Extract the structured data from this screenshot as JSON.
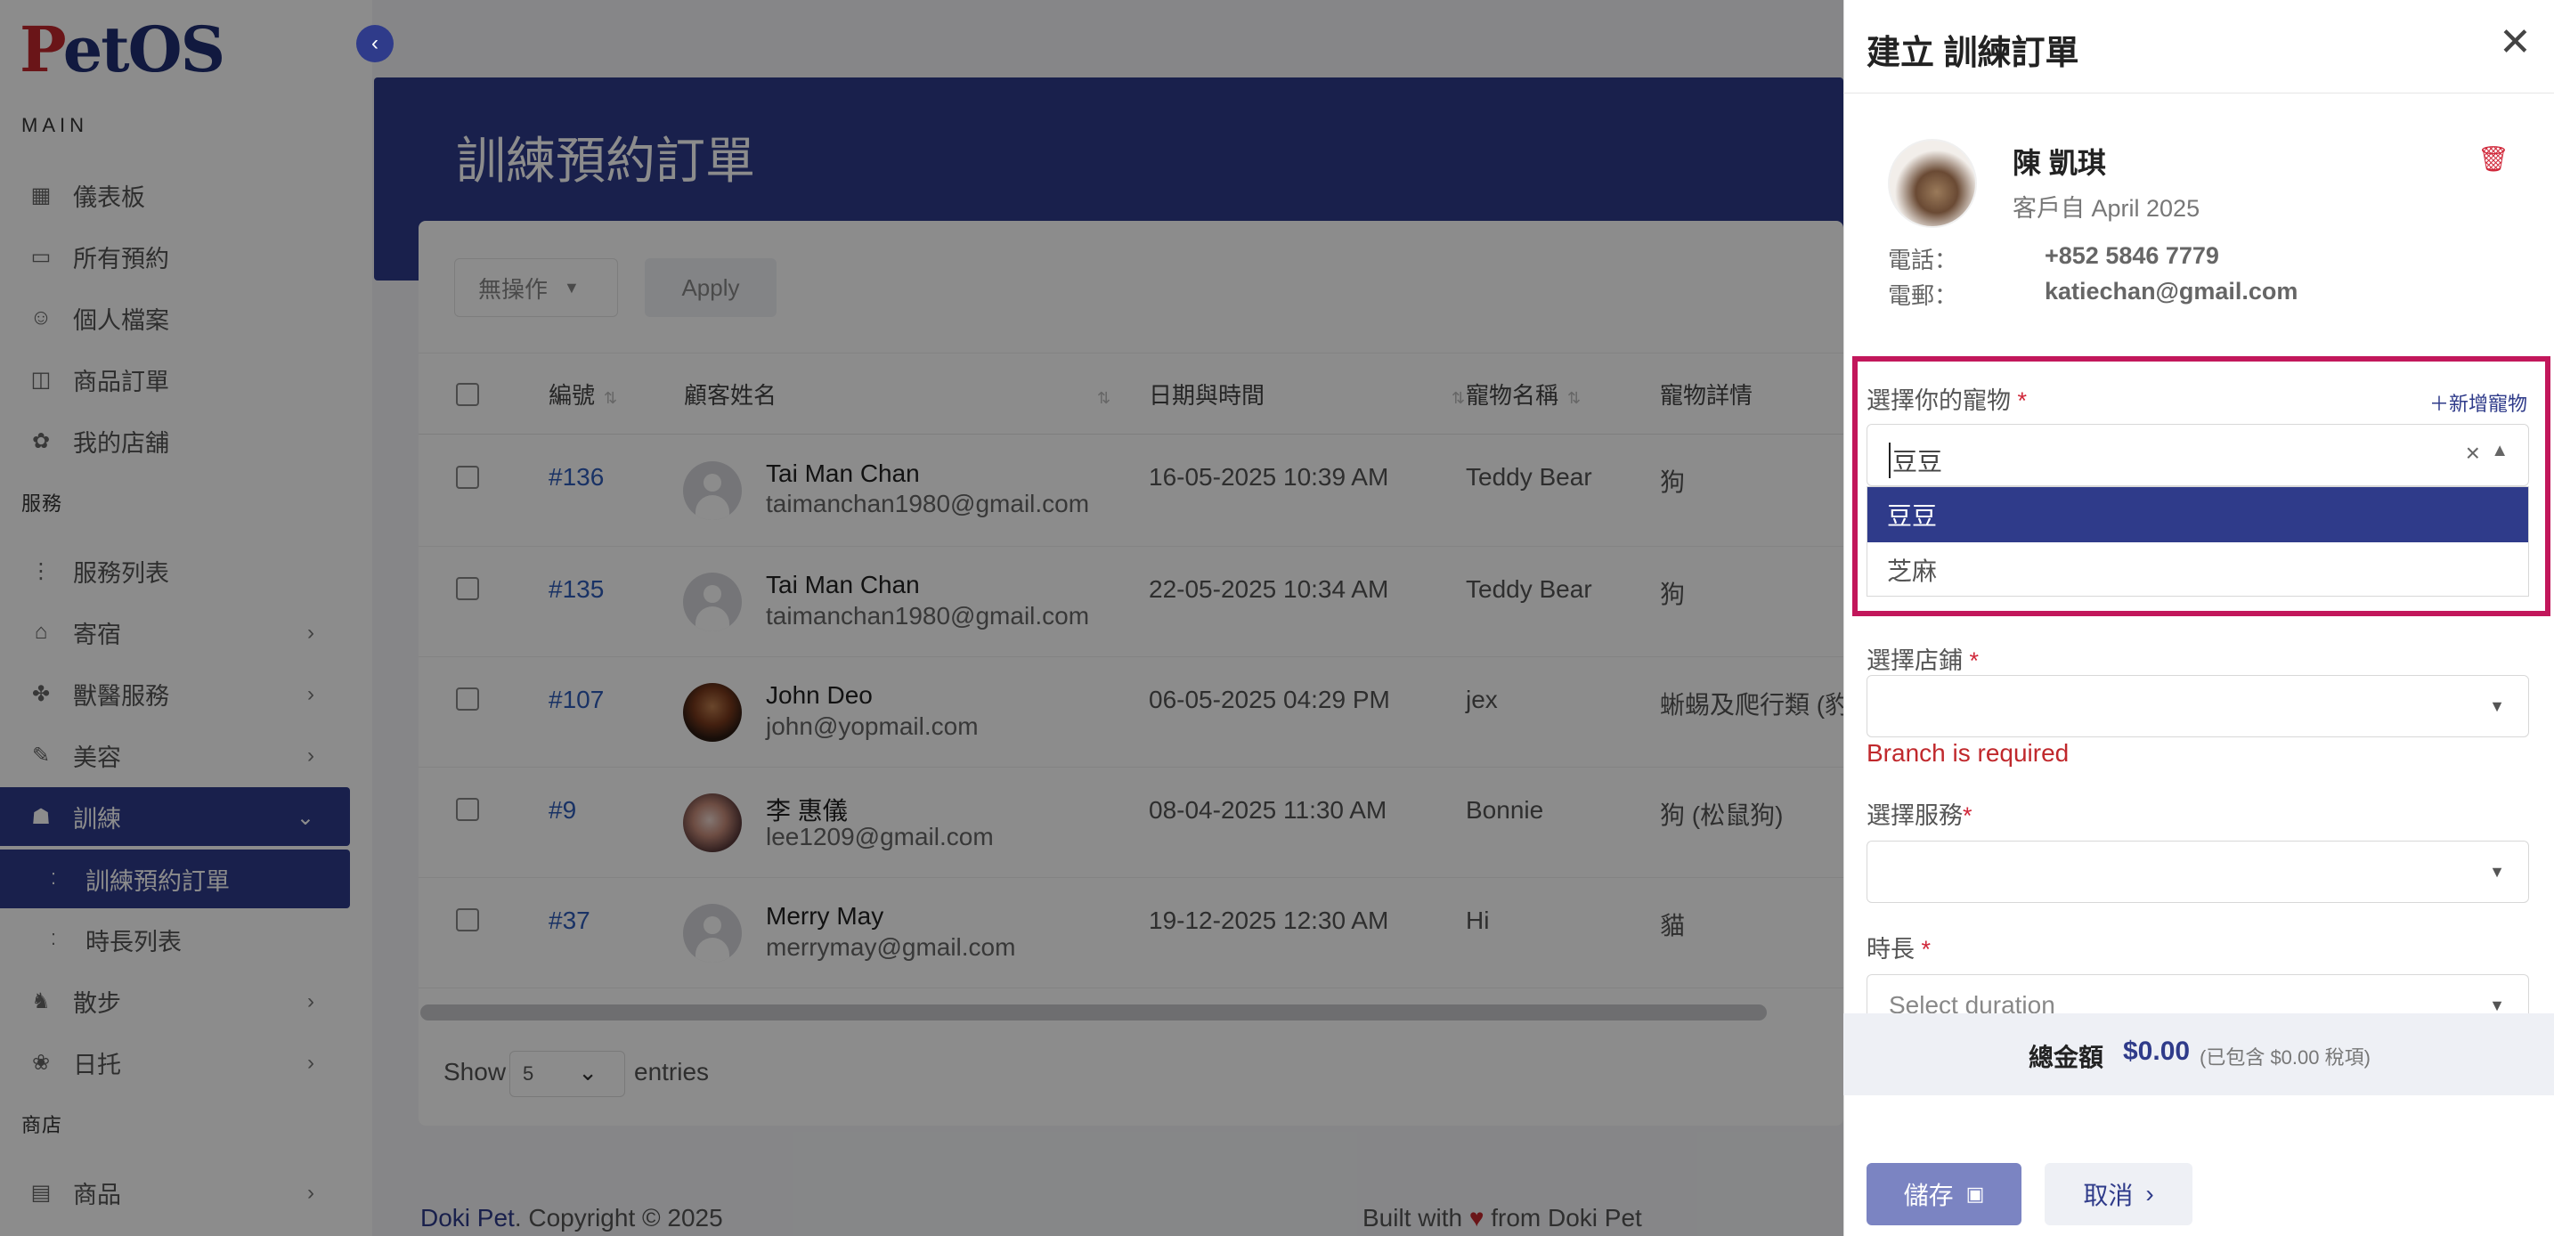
{
  "app": {
    "logo_p": "P",
    "logo_rest": "etOS"
  },
  "sidebar": {
    "section_main": "MAIN",
    "section_services": "服務",
    "section_shop": "商店",
    "items": [
      {
        "label": "儀表板",
        "icon": "dashboard-icon"
      },
      {
        "label": "所有預約",
        "icon": "calendar-icon"
      },
      {
        "label": "個人檔案",
        "icon": "user-icon"
      },
      {
        "label": "商品訂單",
        "icon": "bag-icon"
      },
      {
        "label": "我的店舖",
        "icon": "store-icon"
      },
      {
        "label": "服務列表",
        "icon": "list-icon"
      },
      {
        "label": "寄宿",
        "icon": "home-icon"
      },
      {
        "label": "獸醫服務",
        "icon": "vet-icon"
      },
      {
        "label": "美容",
        "icon": "brush-icon"
      },
      {
        "label": "訓練",
        "icon": "training-icon"
      },
      {
        "label": "訓練預約訂單",
        "icon": "sub-icon"
      },
      {
        "label": "時長列表",
        "icon": "sub-icon"
      },
      {
        "label": "散步",
        "icon": "walk-icon"
      },
      {
        "label": "日托",
        "icon": "daycare-icon"
      },
      {
        "label": "商品",
        "icon": "product-icon"
      }
    ]
  },
  "page": {
    "title": "訓練預約訂單",
    "bulk_action": "無操作",
    "apply": "Apply",
    "columns": [
      "編號",
      "顧客姓名",
      "日期與時間",
      "寵物名稱",
      "寵物詳情"
    ],
    "rows": [
      {
        "id": "#136",
        "name": "Tai Man Chan",
        "email": "taimanchan1980@gmail.com",
        "datetime": "16-05-2025 10:39 AM",
        "pet": "Teddy Bear",
        "detail": "狗"
      },
      {
        "id": "#135",
        "name": "Tai Man Chan",
        "email": "taimanchan1980@gmail.com",
        "datetime": "22-05-2025 10:34 AM",
        "pet": "Teddy Bear",
        "detail": "狗"
      },
      {
        "id": "#107",
        "name": "John Deo",
        "email": "john@yopmail.com",
        "datetime": "06-05-2025 04:29 PM",
        "pet": "jex",
        "detail": "蜥蜴及爬行類 (豹紋"
      },
      {
        "id": "#9",
        "name": "李 惠儀",
        "email": "lee1209@gmail.com",
        "datetime": "08-04-2025 11:30 AM",
        "pet": "Bonnie",
        "detail": "狗 (松鼠狗)"
      },
      {
        "id": "#37",
        "name": "Merry May",
        "email": "merrymay@gmail.com",
        "datetime": "19-12-2025 12:30 AM",
        "pet": "Hi",
        "detail": "貓"
      }
    ],
    "show": "Show",
    "entries_value": "5",
    "entries": "entries",
    "footer_brand": "Doki Pet",
    "footer_copy": ". Copyright © 2025",
    "footer_built": "Built with",
    "footer_from": "from Doki Pet"
  },
  "panel": {
    "title": "建立 訓練訂單",
    "customer_name": "陳 凱琪",
    "customer_since": "客戶自 April 2025",
    "phone_label": "電話：",
    "phone": "+852 5846 7779",
    "email_label": "電郵：",
    "email": "katiechan@gmail.com",
    "pet_label": "選擇你的寵物",
    "add_pet": "新增寵物",
    "pet_value": "豆豆",
    "pet_options": [
      "豆豆",
      "芝麻"
    ],
    "branch_label": "選擇店鋪",
    "branch_error": "Branch is required",
    "service_label": "選擇服務",
    "duration_label": "時長",
    "duration_placeholder": "Select duration",
    "required_mark": "*",
    "total_label": "總金額",
    "total_value": "$0.00",
    "total_tax": "(已包含 $0.00 稅項)",
    "save": "儲存",
    "cancel": "取消"
  },
  "colors": {
    "primary": "#2f3b8a",
    "brand_red": "#c2272d",
    "highlight": "#c2175b",
    "error": "#c0282c"
  }
}
